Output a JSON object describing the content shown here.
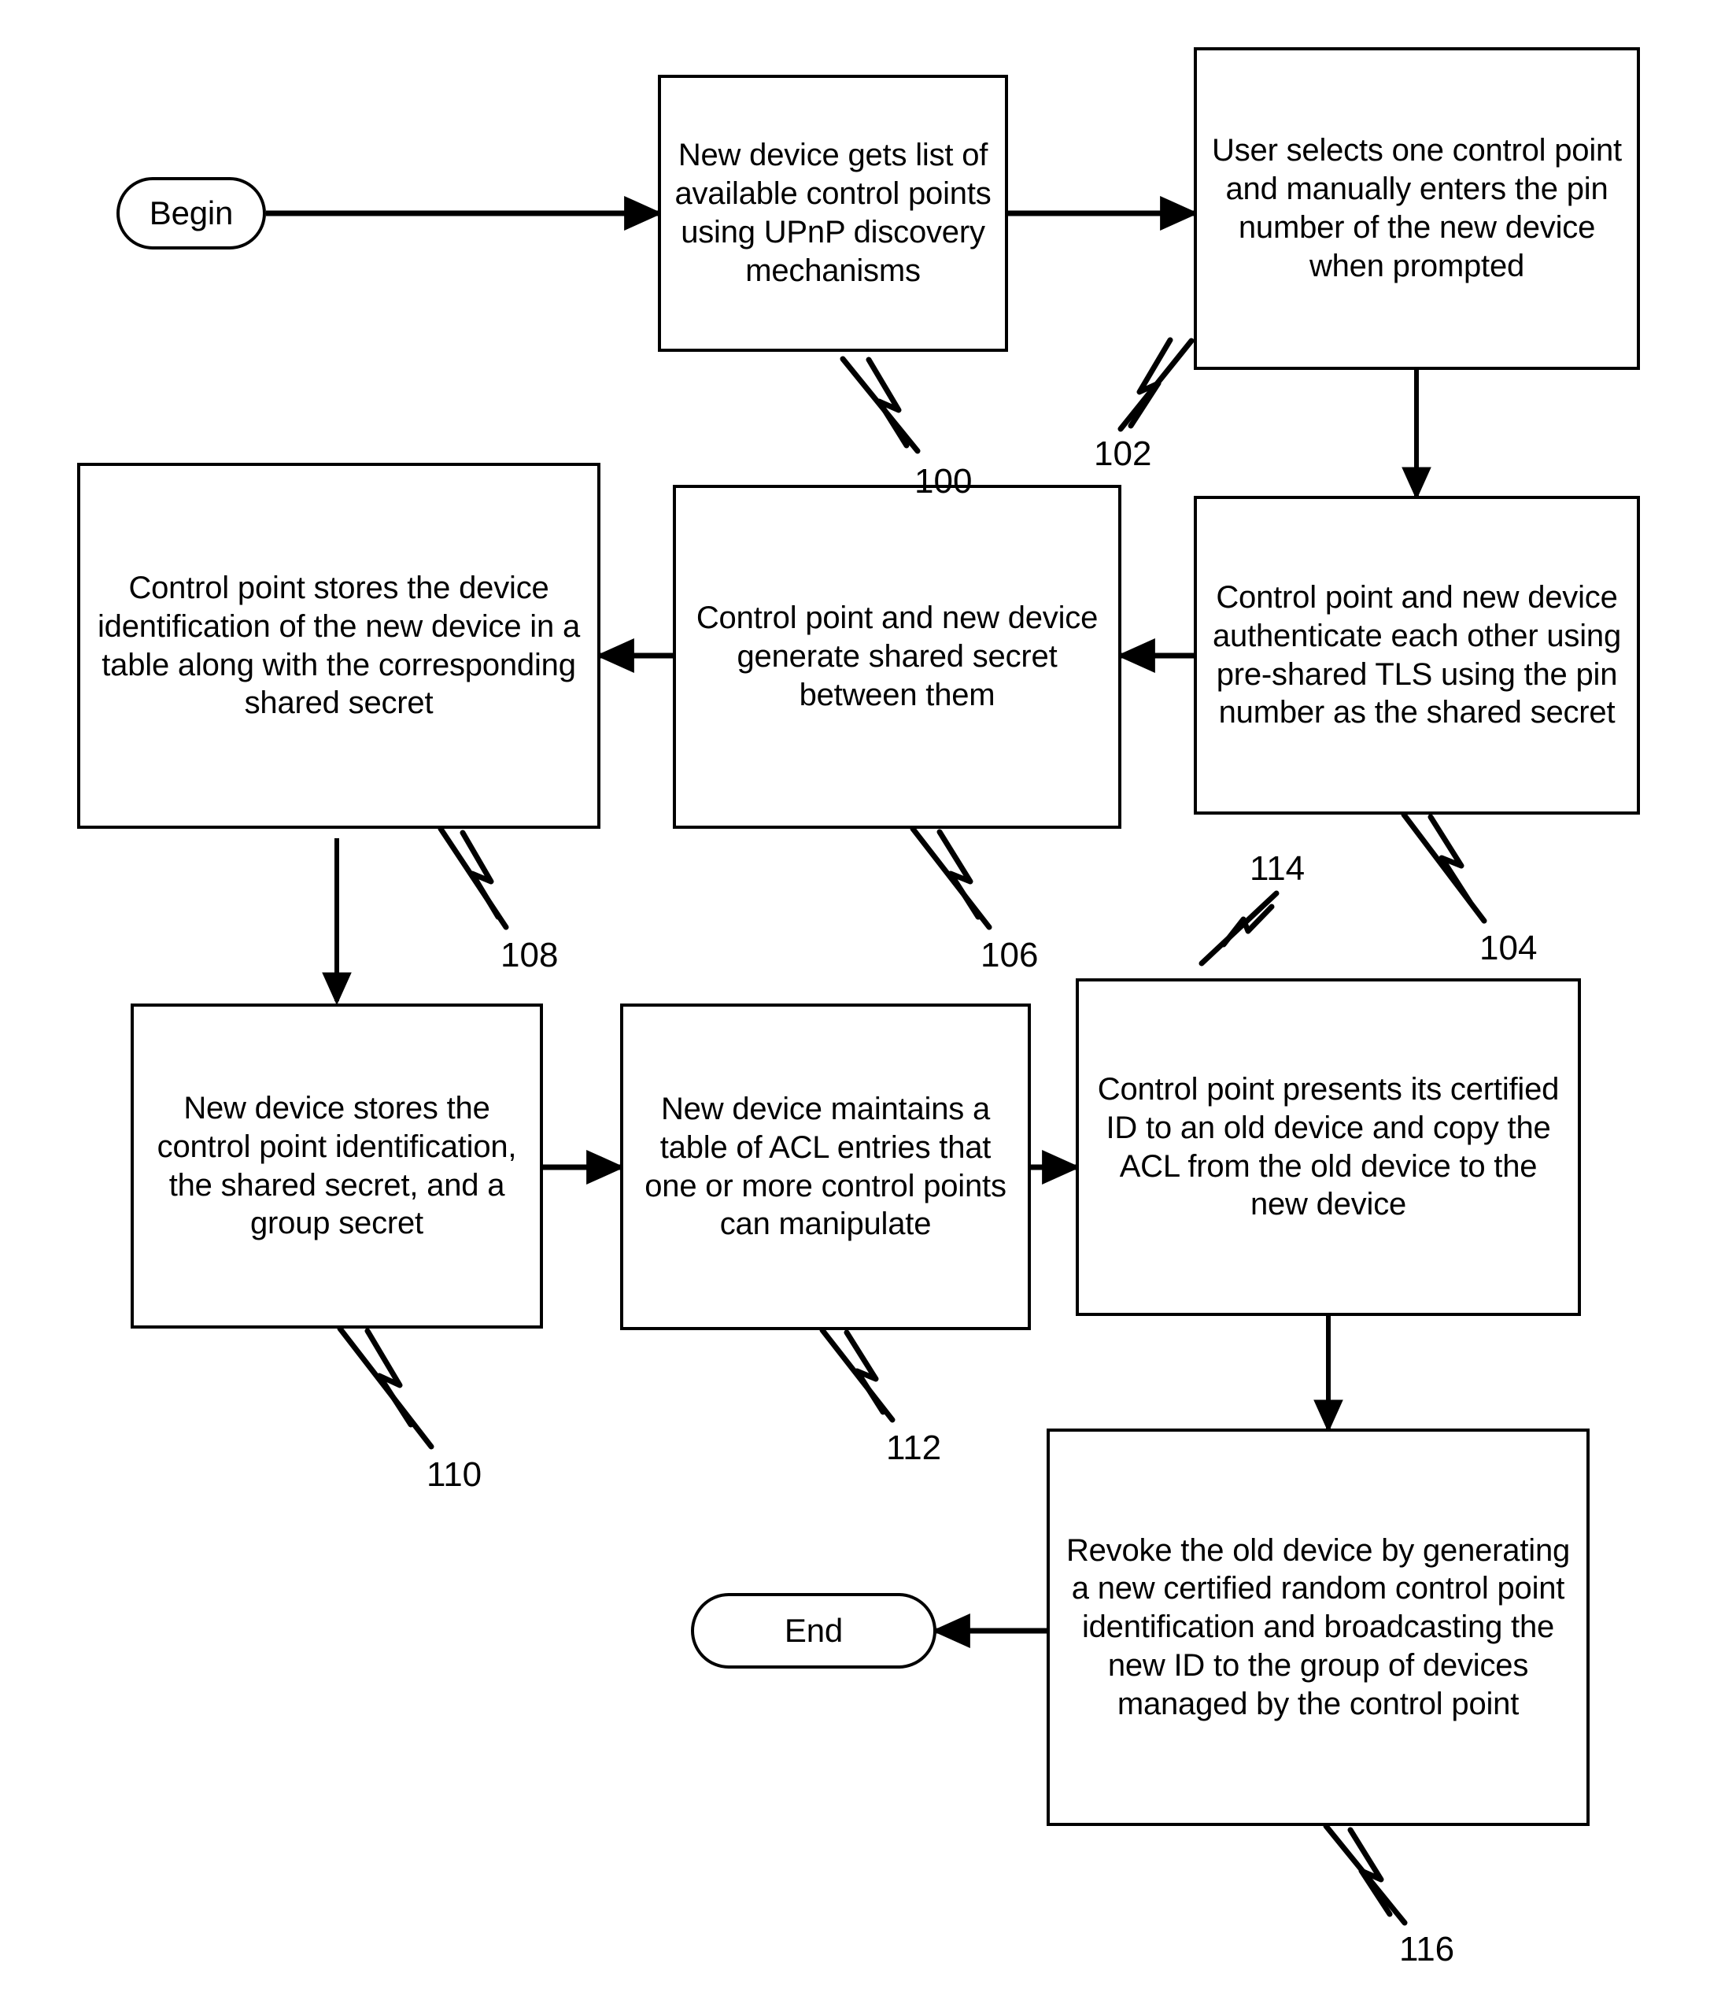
{
  "figure": {
    "type": "flowchart",
    "orientation": "serpentine",
    "background": "#ffffff",
    "stroke": "#000000"
  },
  "nodes": {
    "begin": {
      "label": "Begin",
      "shape": "terminal"
    },
    "n100": {
      "label": "New device gets list of available control points using UPnP discovery mechanisms",
      "shape": "process",
      "ref": "100"
    },
    "n102": {
      "label": "User selects one control point and manually enters the pin number of the new device when prompted",
      "shape": "process",
      "ref": "102"
    },
    "n104": {
      "label": "Control point and new device authenticate each other using pre-shared TLS using the pin number as the shared secret",
      "shape": "process",
      "ref": "104"
    },
    "n106": {
      "label": "Control point and new device generate shared secret between them",
      "shape": "process",
      "ref": "106"
    },
    "n108": {
      "label": "Control point stores the device identification of the new device in a table along with the corresponding shared secret",
      "shape": "process",
      "ref": "108"
    },
    "n110": {
      "label": "New device stores the control point identification, the shared secret, and a group secret",
      "shape": "process",
      "ref": "110"
    },
    "n112": {
      "label": "New device maintains a table of ACL entries that one or more control points can manipulate",
      "shape": "process",
      "ref": "112"
    },
    "n114": {
      "label": "Control point presents its certified ID to an old device and copy the ACL from the old device to the new device",
      "shape": "process",
      "ref": "114"
    },
    "n116": {
      "label": "Revoke the old device by generating a new certified random control point identification and broadcasting the new ID to the group of devices managed by the control point",
      "shape": "process",
      "ref": "116"
    },
    "end": {
      "label": "End",
      "shape": "terminal"
    }
  },
  "reference_numerals": {
    "r100": "100",
    "r102": "102",
    "r104": "104",
    "r106": "106",
    "r108": "108",
    "r110": "110",
    "r112": "112",
    "r114": "114",
    "r116": "116"
  },
  "edges": [
    {
      "from": "begin",
      "to": "n100",
      "direction": "right"
    },
    {
      "from": "n100",
      "to": "n102",
      "direction": "right"
    },
    {
      "from": "n102",
      "to": "n104",
      "direction": "down"
    },
    {
      "from": "n104",
      "to": "n106",
      "direction": "left"
    },
    {
      "from": "n106",
      "to": "n108",
      "direction": "left"
    },
    {
      "from": "n108",
      "to": "n110",
      "direction": "down"
    },
    {
      "from": "n110",
      "to": "n112",
      "direction": "right"
    },
    {
      "from": "n112",
      "to": "n114",
      "direction": "right"
    },
    {
      "from": "n114",
      "to": "n116",
      "direction": "down"
    },
    {
      "from": "n116",
      "to": "end",
      "direction": "left"
    }
  ]
}
